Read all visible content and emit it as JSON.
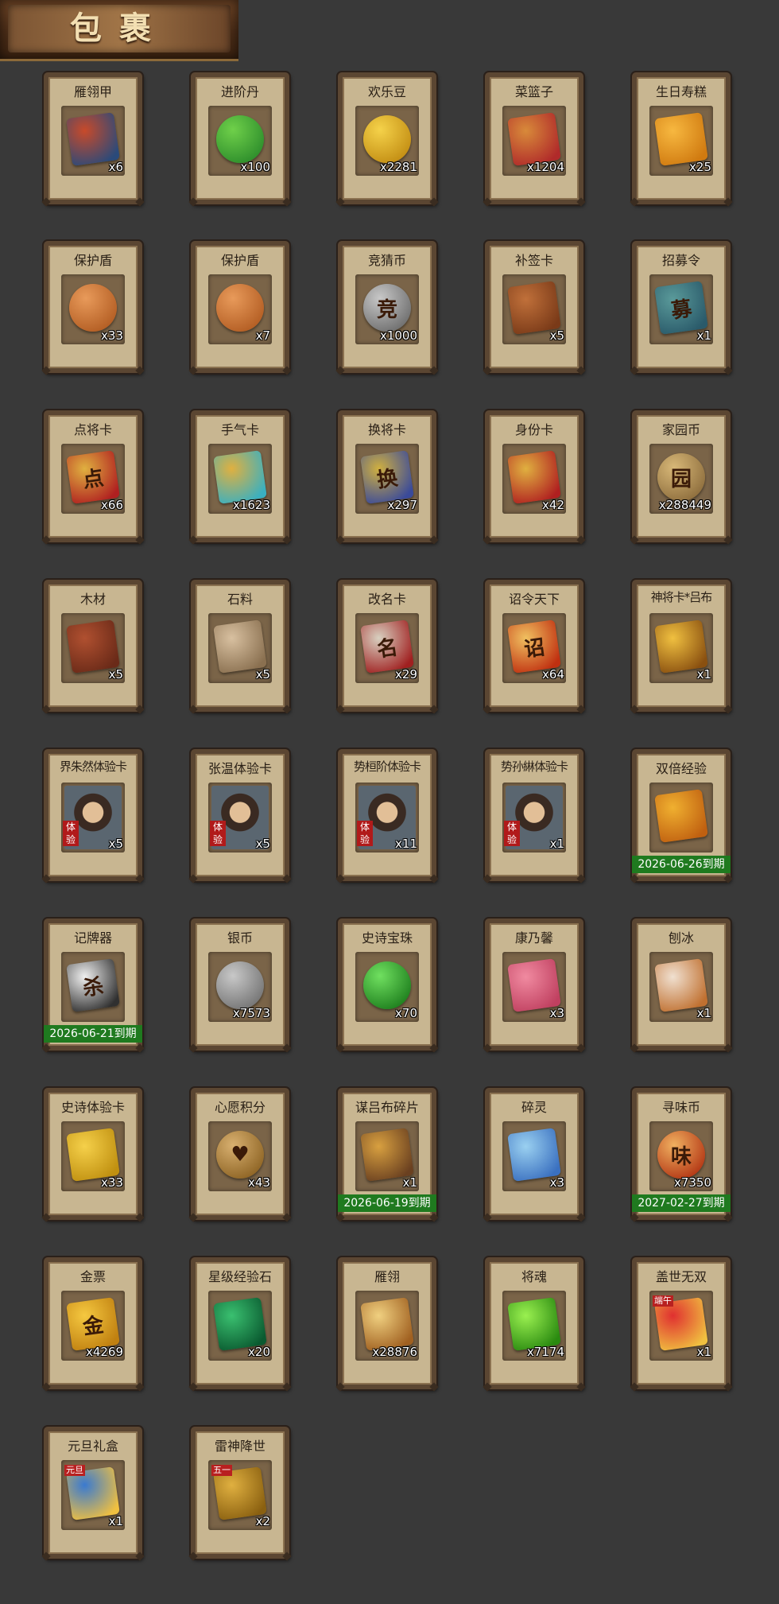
{
  "header": {
    "title": "包裹"
  },
  "items": [
    {
      "name": "雁翎甲",
      "qty": "x6",
      "icon": "armor-icon",
      "c1": "#c84a2a",
      "c2": "#2a4a7a",
      "glyph": ""
    },
    {
      "name": "进阶丹",
      "qty": "x100",
      "icon": "green-pill-icon",
      "c1": "#6fd04a",
      "c2": "#2a8a2a",
      "glyph": ""
    },
    {
      "name": "欢乐豆",
      "qty": "x2281",
      "icon": "gold-beans-icon",
      "c1": "#f5d24a",
      "c2": "#c08a10",
      "glyph": ""
    },
    {
      "name": "菜篮子",
      "qty": "x1204",
      "icon": "basket-icon",
      "c1": "#d88a3a",
      "c2": "#b02a2a",
      "glyph": ""
    },
    {
      "name": "生日寿糕",
      "qty": "x25",
      "icon": "cake-icon",
      "c1": "#f7b840",
      "c2": "#d07a10",
      "glyph": ""
    },
    {
      "name": "保护盾",
      "qty": "x33",
      "icon": "shield-icon",
      "c1": "#e89a5a",
      "c2": "#b05a20",
      "glyph": ""
    },
    {
      "name": "保护盾",
      "qty": "x7",
      "icon": "shield-icon",
      "c1": "#e89a5a",
      "c2": "#b05a20",
      "glyph": ""
    },
    {
      "name": "竞猜币",
      "qty": "x1000",
      "icon": "silver-coin-icon",
      "c1": "#c8c8c8",
      "c2": "#6a6a6a",
      "glyph": "竞"
    },
    {
      "name": "补签卡",
      "qty": "x5",
      "icon": "tag-card-icon",
      "c1": "#c0703a",
      "c2": "#7a3a18",
      "glyph": ""
    },
    {
      "name": "招募令",
      "qty": "x1",
      "icon": "recruit-token-icon",
      "c1": "#5a9a9a",
      "c2": "#2a5a6a",
      "glyph": "募"
    },
    {
      "name": "点将卡",
      "qty": "x66",
      "icon": "general-card-icon",
      "c1": "#e0b040",
      "c2": "#b02020",
      "glyph": "点"
    },
    {
      "name": "手气卡",
      "qty": "x1623",
      "icon": "luck-card-icon",
      "c1": "#e0b040",
      "c2": "#3ab0c0",
      "glyph": ""
    },
    {
      "name": "换将卡",
      "qty": "x297",
      "icon": "swap-card-icon",
      "c1": "#d0b040",
      "c2": "#3a4a9a",
      "glyph": "换"
    },
    {
      "name": "身份卡",
      "qty": "x42",
      "icon": "identity-card-icon",
      "c1": "#e0b040",
      "c2": "#b02020",
      "glyph": ""
    },
    {
      "name": "家园币",
      "qty": "x288449",
      "icon": "home-coin-icon",
      "c1": "#d8b878",
      "c2": "#8a6a3a",
      "glyph": "园"
    },
    {
      "name": "木材",
      "qty": "x5",
      "icon": "wood-icon",
      "c1": "#b05030",
      "c2": "#6a2a18",
      "glyph": ""
    },
    {
      "name": "石料",
      "qty": "x5",
      "icon": "stone-icon",
      "c1": "#d8c0a0",
      "c2": "#8a7050",
      "glyph": ""
    },
    {
      "name": "改名卡",
      "qty": "x29",
      "icon": "rename-card-icon",
      "c1": "#d8d0c0",
      "c2": "#a02020",
      "glyph": "名"
    },
    {
      "name": "诏令天下",
      "qty": "x64",
      "icon": "scroll-icon",
      "c1": "#f0c060",
      "c2": "#c03010",
      "glyph": "诏"
    },
    {
      "name": "神将卡*吕布",
      "qty": "x1",
      "icon": "god-general-card-icon",
      "c1": "#f0c040",
      "c2": "#8a5010",
      "glyph": ""
    },
    {
      "name": "界朱然体验卡",
      "qty": "x5",
      "icon": "trial-card-icon",
      "c1": "#c0a080",
      "c2": "#3a3a4a",
      "glyph": "",
      "portrait": true,
      "tiyan": "体验"
    },
    {
      "name": "张温体验卡",
      "qty": "x5",
      "icon": "trial-card-icon",
      "c1": "#c0a080",
      "c2": "#3a3a4a",
      "glyph": "",
      "portrait": true,
      "tiyan": "体验"
    },
    {
      "name": "势桓阶体验卡",
      "qty": "x11",
      "icon": "trial-card-icon",
      "c1": "#c0a080",
      "c2": "#3a3a4a",
      "glyph": "",
      "portrait": true,
      "tiyan": "体验"
    },
    {
      "name": "势孙綝体验卡",
      "qty": "x1",
      "icon": "trial-card-icon",
      "c1": "#c0a080",
      "c2": "#3a3a4a",
      "glyph": "",
      "portrait": true,
      "tiyan": "体验"
    },
    {
      "name": "双倍经验",
      "qty": "",
      "icon": "ruyi-icon",
      "c1": "#f0b030",
      "c2": "#c06010",
      "glyph": "",
      "expiry": "2026-06-26到期"
    },
    {
      "name": "记牌器",
      "qty": "",
      "icon": "cards-icon",
      "c1": "#f0f0f0",
      "c2": "#303030",
      "glyph": "杀",
      "expiry": "2026-06-21到期"
    },
    {
      "name": "银币",
      "qty": "x7573",
      "icon": "silver-coins-icon",
      "c1": "#c8c8c8",
      "c2": "#707070",
      "glyph": ""
    },
    {
      "name": "史诗宝珠",
      "qty": "x70",
      "icon": "green-orb-icon",
      "c1": "#70e060",
      "c2": "#1a7a1a",
      "glyph": ""
    },
    {
      "name": "康乃馨",
      "qty": "x3",
      "icon": "carnation-icon",
      "c1": "#f08aa0",
      "c2": "#c04060",
      "glyph": ""
    },
    {
      "name": "刨冰",
      "qty": "x1",
      "icon": "shaved-ice-icon",
      "c1": "#f0e0d0",
      "c2": "#c07030",
      "glyph": ""
    },
    {
      "name": "史诗体验卡",
      "qty": "x33",
      "icon": "gold-card-icon",
      "c1": "#f5d04a",
      "c2": "#c09010",
      "glyph": ""
    },
    {
      "name": "心愿积分",
      "qty": "x43",
      "icon": "heart-coin-icon",
      "c1": "#d8b070",
      "c2": "#8a6020",
      "glyph": "♥"
    },
    {
      "name": "谋吕布碎片",
      "qty": "x1",
      "icon": "puzzle-piece-icon",
      "c1": "#d8a040",
      "c2": "#6a4020",
      "glyph": "",
      "expiry": "2026-06-19到期"
    },
    {
      "name": "碎灵",
      "qty": "x3",
      "icon": "crystal-icon",
      "c1": "#9ad0f0",
      "c2": "#3a70c0",
      "glyph": ""
    },
    {
      "name": "寻味币",
      "qty": "x7350",
      "icon": "flavor-coin-icon",
      "c1": "#f0b060",
      "c2": "#b03010",
      "glyph": "味",
      "expiry": "2027-02-27到期"
    },
    {
      "name": "金票",
      "qty": "x4269",
      "icon": "gold-ticket-icon",
      "c1": "#f5c840",
      "c2": "#c08010",
      "glyph": "金"
    },
    {
      "name": "星级经验石",
      "qty": "x20",
      "icon": "jade-stone-icon",
      "c1": "#3ac070",
      "c2": "#0a5a30",
      "glyph": ""
    },
    {
      "name": "雁翎",
      "qty": "x28876",
      "icon": "feather-icon",
      "c1": "#f0d080",
      "c2": "#a06020",
      "glyph": ""
    },
    {
      "name": "将魂",
      "qty": "x7174",
      "icon": "soul-gem-icon",
      "c1": "#9af050",
      "c2": "#2a8a10",
      "glyph": ""
    },
    {
      "name": "盖世无双",
      "qty": "x1",
      "icon": "red-gift-box-icon",
      "c1": "#e03030",
      "c2": "#f0c040",
      "glyph": "",
      "badge": "端午"
    },
    {
      "name": "元旦礼盒",
      "qty": "x1",
      "icon": "blue-gift-box-icon",
      "c1": "#3a7ad0",
      "c2": "#f0c040",
      "glyph": "",
      "badge": "元旦"
    },
    {
      "name": "雷神降世",
      "qty": "x2",
      "icon": "gold-gift-box-icon",
      "c1": "#e0b040",
      "c2": "#8a6010",
      "glyph": "",
      "badge": "五一"
    }
  ]
}
